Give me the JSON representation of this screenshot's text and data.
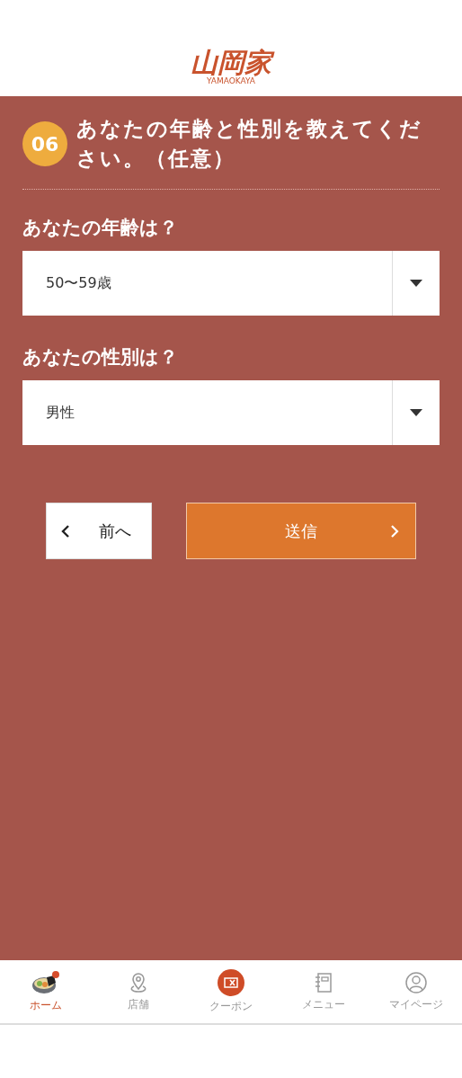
{
  "header": {
    "logo": "山岡家",
    "logo_sub": "YAMAOKAYA"
  },
  "question": {
    "number": "06",
    "title": "あなたの年齢と性別を教えてください。（任意）"
  },
  "fields": [
    {
      "label": "あなたの年齢は？",
      "value": "50〜59歳"
    },
    {
      "label": "あなたの性別は？",
      "value": "男性"
    }
  ],
  "buttons": {
    "back": "前へ",
    "submit": "送信"
  },
  "nav": [
    {
      "label": "ホーム",
      "selected": true,
      "kind": "bowl"
    },
    {
      "label": "店舗",
      "selected": false,
      "kind": "pin"
    },
    {
      "label": "クーポン",
      "selected": false,
      "kind": "coupon"
    },
    {
      "label": "メニュー",
      "selected": false,
      "kind": "book"
    },
    {
      "label": "マイページ",
      "selected": false,
      "kind": "user"
    }
  ]
}
